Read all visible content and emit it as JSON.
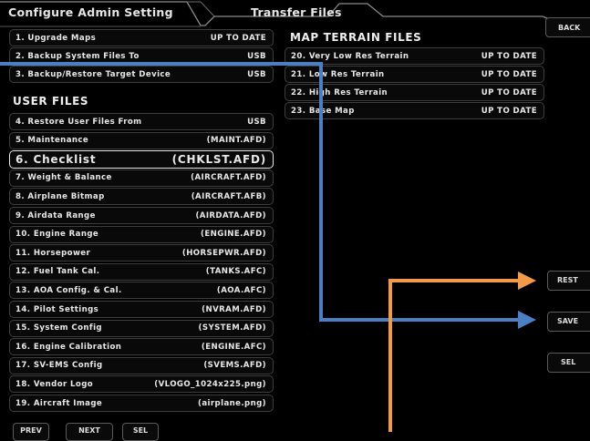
{
  "tabs": {
    "admin": "Configure Admin Setting",
    "transfer": "Transfer Files"
  },
  "back_button": "BACK",
  "config_rows": [
    {
      "label": "1. Upgrade Maps",
      "value": "UP TO DATE"
    },
    {
      "label": "2. Backup System Files To",
      "value": "USB"
    },
    {
      "label": "3. Backup/Restore Target Device",
      "value": "USB"
    }
  ],
  "user_files_header": "USER FILES",
  "user_files": [
    {
      "label": "4. Restore User Files From",
      "value": "USB"
    },
    {
      "label": "5. Maintenance",
      "value": "(MAINT.AFD)"
    },
    {
      "label": "6. Checklist",
      "value": "(CHKLST.AFD)"
    },
    {
      "label": "7. Weight & Balance",
      "value": "(AIRCRAFT.AFD)"
    },
    {
      "label": "8. Airplane Bitmap",
      "value": "(AIRCRAFT.AFB)"
    },
    {
      "label": "9. Airdata Range",
      "value": "(AIRDATA.AFD)"
    },
    {
      "label": "10. Engine Range",
      "value": "(ENGINE.AFD)"
    },
    {
      "label": "11. Horsepower",
      "value": "(HORSEPWR.AFD)"
    },
    {
      "label": "12. Fuel Tank Cal.",
      "value": "(TANKS.AFC)"
    },
    {
      "label": "13. AOA Config. & Cal.",
      "value": "(AOA.AFC)"
    },
    {
      "label": "14. Pilot Settings",
      "value": "(NVRAM.AFD)"
    },
    {
      "label": "15. System Config",
      "value": "(SYSTEM.AFD)"
    },
    {
      "label": "16. Engine Calibration",
      "value": "(ENGINE.AFC)"
    },
    {
      "label": "17. SV-EMS Config",
      "value": "(SVEMS.AFD)"
    },
    {
      "label": "18. Vendor Logo",
      "value": "(VLOGO_1024x225.png)"
    },
    {
      "label": "19. Aircraft Image",
      "value": "(airplane.png)"
    }
  ],
  "selected_item": "6. Checklist",
  "map_terrain_header": "MAP TERRAIN FILES",
  "map_files": [
    {
      "label": "20. Very Low Res Terrain",
      "value": "UP TO DATE"
    },
    {
      "label": "21. Low Res Terrain",
      "value": "UP TO DATE"
    },
    {
      "label": "22. High Res Terrain",
      "value": "UP TO DATE"
    },
    {
      "label": "23. Base Map",
      "value": "UP TO DATE"
    }
  ],
  "softkeys_right": {
    "rest": "REST",
    "save": "SAVE",
    "sel": "SEL"
  },
  "softkeys_bottom": {
    "prev": "PREV",
    "next": "NEXT",
    "sel": "SEL"
  },
  "colors": {
    "blue_arrow": "#4a7fc4",
    "orange_arrow": "#f29a4a",
    "background": "#000000",
    "row_border": "#3e3e3e"
  }
}
